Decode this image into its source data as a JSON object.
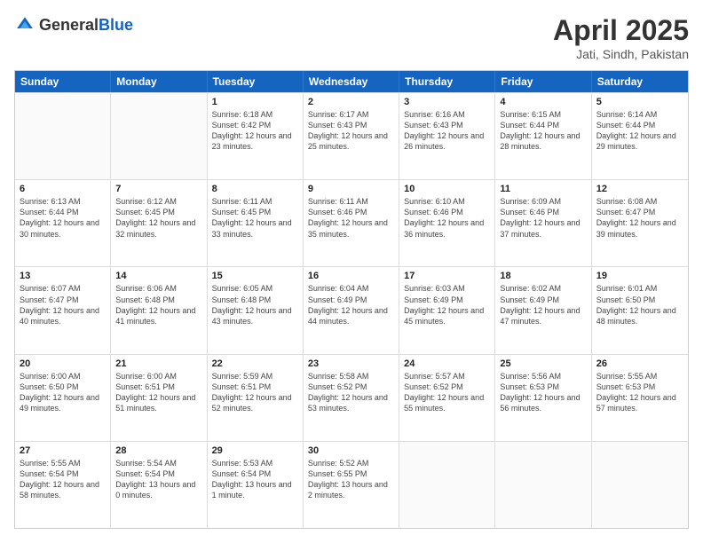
{
  "header": {
    "logo_general": "General",
    "logo_blue": "Blue",
    "title": "April 2025",
    "location": "Jati, Sindh, Pakistan"
  },
  "calendar": {
    "days_of_week": [
      "Sunday",
      "Monday",
      "Tuesday",
      "Wednesday",
      "Thursday",
      "Friday",
      "Saturday"
    ],
    "weeks": [
      [
        {
          "day": "",
          "sunrise": "",
          "sunset": "",
          "daylight": "",
          "empty": true
        },
        {
          "day": "",
          "sunrise": "",
          "sunset": "",
          "daylight": "",
          "empty": true
        },
        {
          "day": "1",
          "sunrise": "Sunrise: 6:18 AM",
          "sunset": "Sunset: 6:42 PM",
          "daylight": "Daylight: 12 hours and 23 minutes.",
          "empty": false
        },
        {
          "day": "2",
          "sunrise": "Sunrise: 6:17 AM",
          "sunset": "Sunset: 6:43 PM",
          "daylight": "Daylight: 12 hours and 25 minutes.",
          "empty": false
        },
        {
          "day": "3",
          "sunrise": "Sunrise: 6:16 AM",
          "sunset": "Sunset: 6:43 PM",
          "daylight": "Daylight: 12 hours and 26 minutes.",
          "empty": false
        },
        {
          "day": "4",
          "sunrise": "Sunrise: 6:15 AM",
          "sunset": "Sunset: 6:44 PM",
          "daylight": "Daylight: 12 hours and 28 minutes.",
          "empty": false
        },
        {
          "day": "5",
          "sunrise": "Sunrise: 6:14 AM",
          "sunset": "Sunset: 6:44 PM",
          "daylight": "Daylight: 12 hours and 29 minutes.",
          "empty": false
        }
      ],
      [
        {
          "day": "6",
          "sunrise": "Sunrise: 6:13 AM",
          "sunset": "Sunset: 6:44 PM",
          "daylight": "Daylight: 12 hours and 30 minutes.",
          "empty": false
        },
        {
          "day": "7",
          "sunrise": "Sunrise: 6:12 AM",
          "sunset": "Sunset: 6:45 PM",
          "daylight": "Daylight: 12 hours and 32 minutes.",
          "empty": false
        },
        {
          "day": "8",
          "sunrise": "Sunrise: 6:11 AM",
          "sunset": "Sunset: 6:45 PM",
          "daylight": "Daylight: 12 hours and 33 minutes.",
          "empty": false
        },
        {
          "day": "9",
          "sunrise": "Sunrise: 6:11 AM",
          "sunset": "Sunset: 6:46 PM",
          "daylight": "Daylight: 12 hours and 35 minutes.",
          "empty": false
        },
        {
          "day": "10",
          "sunrise": "Sunrise: 6:10 AM",
          "sunset": "Sunset: 6:46 PM",
          "daylight": "Daylight: 12 hours and 36 minutes.",
          "empty": false
        },
        {
          "day": "11",
          "sunrise": "Sunrise: 6:09 AM",
          "sunset": "Sunset: 6:46 PM",
          "daylight": "Daylight: 12 hours and 37 minutes.",
          "empty": false
        },
        {
          "day": "12",
          "sunrise": "Sunrise: 6:08 AM",
          "sunset": "Sunset: 6:47 PM",
          "daylight": "Daylight: 12 hours and 39 minutes.",
          "empty": false
        }
      ],
      [
        {
          "day": "13",
          "sunrise": "Sunrise: 6:07 AM",
          "sunset": "Sunset: 6:47 PM",
          "daylight": "Daylight: 12 hours and 40 minutes.",
          "empty": false
        },
        {
          "day": "14",
          "sunrise": "Sunrise: 6:06 AM",
          "sunset": "Sunset: 6:48 PM",
          "daylight": "Daylight: 12 hours and 41 minutes.",
          "empty": false
        },
        {
          "day": "15",
          "sunrise": "Sunrise: 6:05 AM",
          "sunset": "Sunset: 6:48 PM",
          "daylight": "Daylight: 12 hours and 43 minutes.",
          "empty": false
        },
        {
          "day": "16",
          "sunrise": "Sunrise: 6:04 AM",
          "sunset": "Sunset: 6:49 PM",
          "daylight": "Daylight: 12 hours and 44 minutes.",
          "empty": false
        },
        {
          "day": "17",
          "sunrise": "Sunrise: 6:03 AM",
          "sunset": "Sunset: 6:49 PM",
          "daylight": "Daylight: 12 hours and 45 minutes.",
          "empty": false
        },
        {
          "day": "18",
          "sunrise": "Sunrise: 6:02 AM",
          "sunset": "Sunset: 6:49 PM",
          "daylight": "Daylight: 12 hours and 47 minutes.",
          "empty": false
        },
        {
          "day": "19",
          "sunrise": "Sunrise: 6:01 AM",
          "sunset": "Sunset: 6:50 PM",
          "daylight": "Daylight: 12 hours and 48 minutes.",
          "empty": false
        }
      ],
      [
        {
          "day": "20",
          "sunrise": "Sunrise: 6:00 AM",
          "sunset": "Sunset: 6:50 PM",
          "daylight": "Daylight: 12 hours and 49 minutes.",
          "empty": false
        },
        {
          "day": "21",
          "sunrise": "Sunrise: 6:00 AM",
          "sunset": "Sunset: 6:51 PM",
          "daylight": "Daylight: 12 hours and 51 minutes.",
          "empty": false
        },
        {
          "day": "22",
          "sunrise": "Sunrise: 5:59 AM",
          "sunset": "Sunset: 6:51 PM",
          "daylight": "Daylight: 12 hours and 52 minutes.",
          "empty": false
        },
        {
          "day": "23",
          "sunrise": "Sunrise: 5:58 AM",
          "sunset": "Sunset: 6:52 PM",
          "daylight": "Daylight: 12 hours and 53 minutes.",
          "empty": false
        },
        {
          "day": "24",
          "sunrise": "Sunrise: 5:57 AM",
          "sunset": "Sunset: 6:52 PM",
          "daylight": "Daylight: 12 hours and 55 minutes.",
          "empty": false
        },
        {
          "day": "25",
          "sunrise": "Sunrise: 5:56 AM",
          "sunset": "Sunset: 6:53 PM",
          "daylight": "Daylight: 12 hours and 56 minutes.",
          "empty": false
        },
        {
          "day": "26",
          "sunrise": "Sunrise: 5:55 AM",
          "sunset": "Sunset: 6:53 PM",
          "daylight": "Daylight: 12 hours and 57 minutes.",
          "empty": false
        }
      ],
      [
        {
          "day": "27",
          "sunrise": "Sunrise: 5:55 AM",
          "sunset": "Sunset: 6:54 PM",
          "daylight": "Daylight: 12 hours and 58 minutes.",
          "empty": false
        },
        {
          "day": "28",
          "sunrise": "Sunrise: 5:54 AM",
          "sunset": "Sunset: 6:54 PM",
          "daylight": "Daylight: 13 hours and 0 minutes.",
          "empty": false
        },
        {
          "day": "29",
          "sunrise": "Sunrise: 5:53 AM",
          "sunset": "Sunset: 6:54 PM",
          "daylight": "Daylight: 13 hours and 1 minute.",
          "empty": false
        },
        {
          "day": "30",
          "sunrise": "Sunrise: 5:52 AM",
          "sunset": "Sunset: 6:55 PM",
          "daylight": "Daylight: 13 hours and 2 minutes.",
          "empty": false
        },
        {
          "day": "",
          "sunrise": "",
          "sunset": "",
          "daylight": "",
          "empty": true
        },
        {
          "day": "",
          "sunrise": "",
          "sunset": "",
          "daylight": "",
          "empty": true
        },
        {
          "day": "",
          "sunrise": "",
          "sunset": "",
          "daylight": "",
          "empty": true
        }
      ]
    ]
  }
}
